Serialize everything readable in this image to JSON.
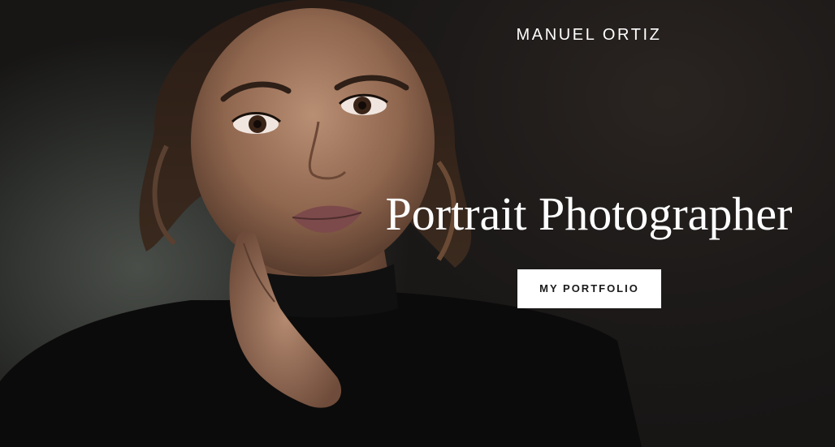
{
  "header": {
    "brand_name": "MANUEL ORTIZ"
  },
  "hero": {
    "headline": "Portrait Photographer",
    "cta_label": "MY PORTFOLIO",
    "background_image": "portrait-photo-woman-black-turtleneck"
  },
  "colors": {
    "background": "#1b1a19",
    "text": "#ffffff",
    "button_bg": "#ffffff",
    "button_text": "#1a1a1a"
  }
}
